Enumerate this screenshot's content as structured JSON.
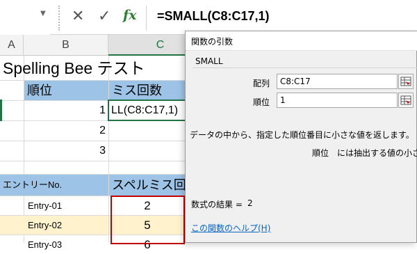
{
  "formula_bar": {
    "formula": "=SMALL(C8:C17,1)",
    "cancel_icon": "close-icon",
    "enter_icon": "check-icon",
    "fx_label": "fx"
  },
  "columns": [
    "A",
    "B",
    "C"
  ],
  "sheet": {
    "title": "Spelling Bee テスト",
    "rank_header": "順位",
    "miss_header": "ミス回数",
    "ranks": [
      "1",
      "2",
      "3"
    ],
    "editing_cell": "LL(C8:C17,1)",
    "entry_header": "エントリーNo.",
    "spell_header": "スペルミス回",
    "entries": [
      {
        "name": "Entry-01",
        "value": "2"
      },
      {
        "name": "Entry-02",
        "value": "5"
      },
      {
        "name": "Entry-03",
        "value": "6"
      }
    ]
  },
  "dialog": {
    "title": "関数の引数",
    "function_name": "SMALL",
    "arg1_label": "配列",
    "arg1_value": "C8:C17",
    "arg2_label": "順位",
    "arg2_value": "1",
    "description": "データの中から、指定した順位番目に小さな値を返します。",
    "arg_help": "順位　には抽出する値の小さいプ",
    "result_label": "数式の結果 =",
    "result_value": "2",
    "help_link": "この関数のヘルプ(H)"
  },
  "colors": {
    "header_fill": "#9dc3e6",
    "highlight_row": "#fff2cc",
    "selection_border": "#c00000",
    "excel_green": "#217346"
  }
}
